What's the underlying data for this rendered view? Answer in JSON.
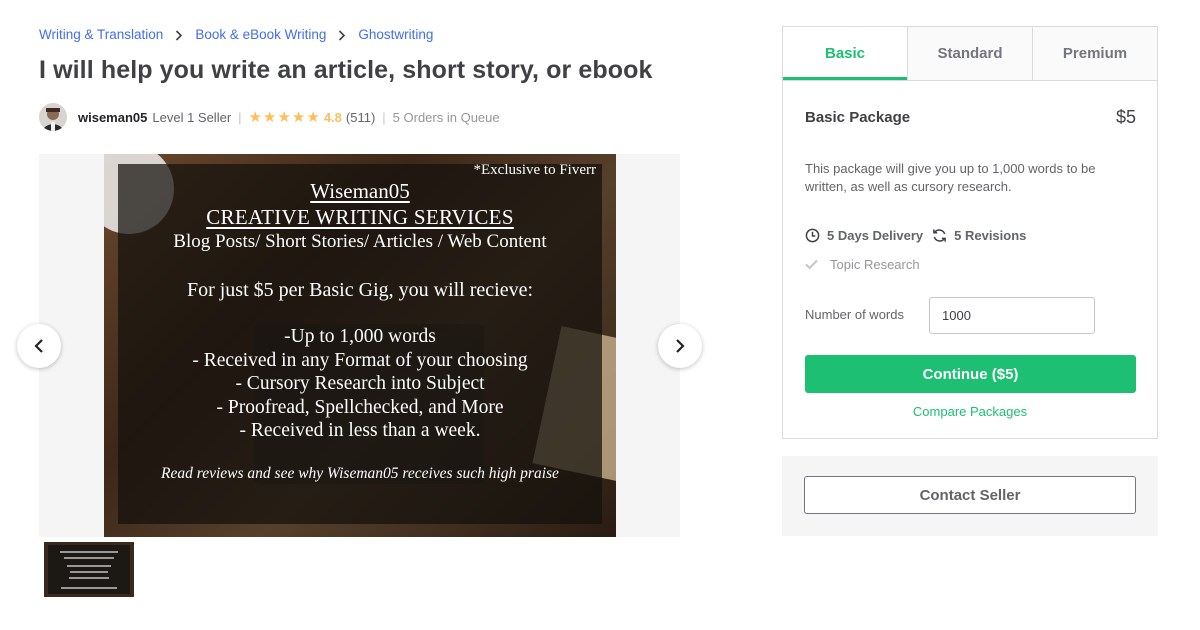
{
  "breadcrumb": [
    "Writing & Translation",
    "Book & eBook Writing",
    "Ghostwriting"
  ],
  "gig_title": "I will help you write an article, short story, or ebook",
  "seller": {
    "username": "wiseman05",
    "level": "Level 1 Seller",
    "rating": "4.8",
    "reviews": "(511)",
    "orders_in_queue": "5 Orders in Queue"
  },
  "gallery": {
    "slide": {
      "exclusive": "*Exclusive to Fiverr",
      "name": "Wiseman05",
      "headline": "CREATIVE WRITING SERVICES",
      "subhead": "Blog Posts/ Short Stories/ Articles / Web Content",
      "offer": "For just $5 per Basic Gig, you will recieve:",
      "bullets": [
        "-Up to 1,000 words",
        "- Received in any Format of your choosing",
        "- Cursory Research into Subject",
        "- Proofread, Spellchecked, and More",
        "- Received in less than a week."
      ],
      "footer": "Read reviews and see why Wiseman05 receives such high praise"
    }
  },
  "packages": {
    "tabs": [
      "Basic",
      "Standard",
      "Premium"
    ],
    "active_tab": "Basic",
    "title": "Basic Package",
    "price": "$5",
    "description": "This package will give you up to 1,000 words to be written, as well as cursory research.",
    "delivery": "5 Days Delivery",
    "revisions": "5 Revisions",
    "features": [
      "Topic Research"
    ],
    "words_label": "Number of words",
    "words_value": "1000",
    "continue_label": "Continue ($5)",
    "compare_label": "Compare Packages"
  },
  "contact_label": "Contact Seller",
  "colors": {
    "accent": "#1dbf73",
    "link": "#446ee7",
    "star": "#ffbe5b"
  }
}
